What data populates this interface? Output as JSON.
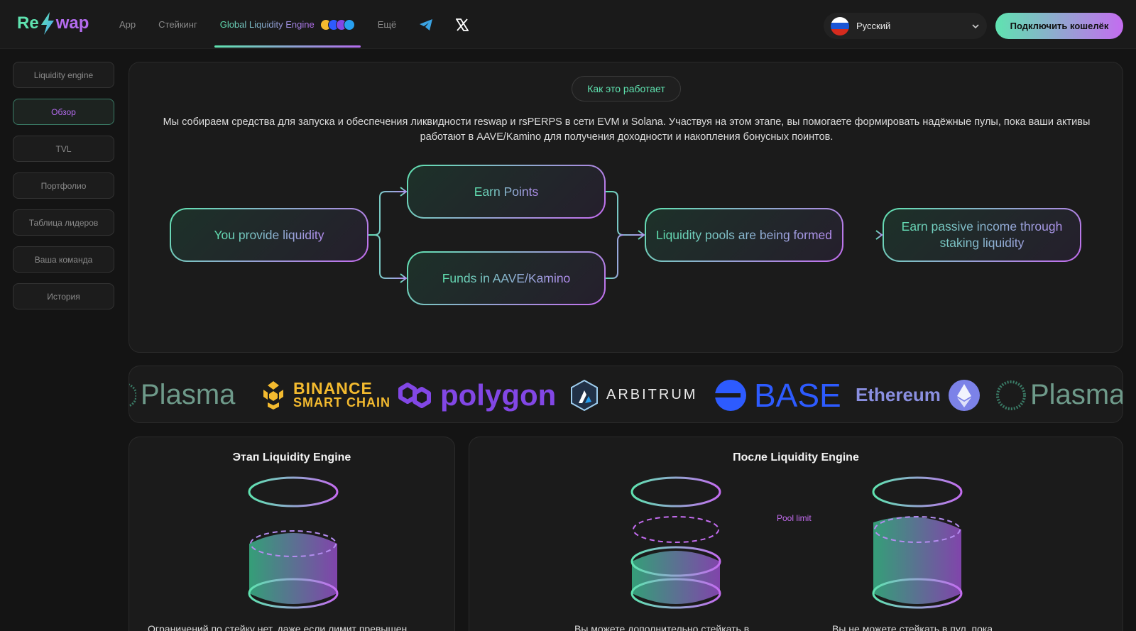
{
  "header": {
    "logo_left": "Re",
    "logo_right": "wap",
    "nav": [
      {
        "label": "App"
      },
      {
        "label": "Стейкинг"
      },
      {
        "label": "Global Liquidity Engine"
      },
      {
        "label": "Ещё"
      }
    ],
    "language": "Русский",
    "connect_label": "Подключить кошелёк"
  },
  "sidebar": {
    "items": [
      {
        "label": "Liquidity engine"
      },
      {
        "label": "Обзор"
      },
      {
        "label": "TVL"
      },
      {
        "label": "Портфолио"
      },
      {
        "label": "Таблица лидеров"
      },
      {
        "label": "Ваша команда"
      },
      {
        "label": "История"
      }
    ]
  },
  "main": {
    "how_it_works": "Как это работает",
    "description": "Мы собираем средства для запуска и обеспечения ликвидности reswap и rsPERPS в сети EVM и Solana. Участвуя на этом этапе, вы помогаете формировать надёжные пулы, пока ваши активы работают в AAVE/Kamino для получения доходности и накопления бонусных поинтов.",
    "flow": {
      "provide": "You provide liquidity",
      "earn_points": "Earn Points",
      "funds": "Funds in AAVE/Kamino",
      "pools": "Liquidity pools are being formed",
      "passive": "Earn passive income through staking liquidity"
    }
  },
  "chains": {
    "plasma": "Plasma",
    "binance_1": "BINANCE",
    "binance_2": "SMART CHAIN",
    "polygon": "polygon",
    "arbitrum": "ARBITRUM",
    "base": "BASE",
    "ethereum": "Ethereum"
  },
  "stages": {
    "during_title": "Этап Liquidity Engine",
    "during_text": "Ограничений по стейку нет, даже если лимит превышен",
    "after_title": "После Liquidity Engine",
    "pool_limit": "Pool limit",
    "after_text_left": "Вы можете дополнительно стейкать в",
    "after_text_right": "Вы не можете стейкать в пул, пока"
  },
  "colors": {
    "accent_green": "#5fe3b0",
    "accent_purple": "#c46cf0",
    "background": "#141414"
  }
}
